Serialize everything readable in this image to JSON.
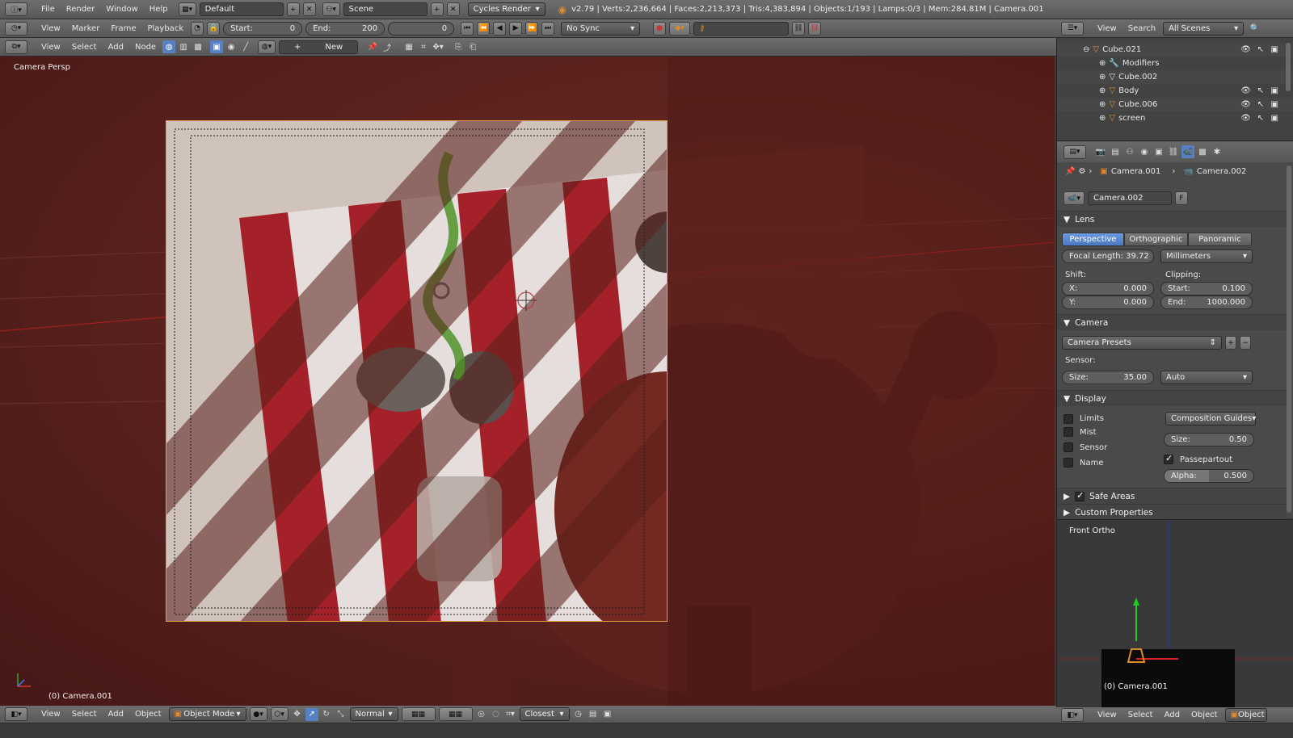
{
  "info_bar": {
    "menus": [
      "File",
      "Render",
      "Window",
      "Help"
    ],
    "layout": "Default",
    "scene": "Scene",
    "engine": "Cycles Render",
    "stats": "v2.79 | Verts:2,236,664 | Faces:2,213,373 | Tris:4,383,894 | Objects:1/193 | Lamps:0/3 | Mem:284.81M | Camera.001"
  },
  "timeline_bar": {
    "menus": [
      "View",
      "Marker",
      "Frame",
      "Playback"
    ],
    "start_label": "Start:",
    "start_value": "0",
    "end_label": "End:",
    "end_value": "200",
    "current_frame": "0",
    "sync": "No Sync"
  },
  "node_bar": {
    "menus": [
      "View",
      "Select",
      "Add",
      "Node"
    ],
    "new_label": "New"
  },
  "viewport": {
    "label": "Camera Persp",
    "footer": "(0) Camera.001"
  },
  "bottom_bar": {
    "menus": [
      "View",
      "Select",
      "Add",
      "Object"
    ],
    "mode": "Object Mode",
    "pivot": "Normal",
    "snap": "Closest"
  },
  "outliner": {
    "menus": [
      "View",
      "Search"
    ],
    "scenes": "All Scenes",
    "rows": [
      {
        "name": "Cube.021",
        "indent": 0
      },
      {
        "name": "Modifiers",
        "indent": 1
      },
      {
        "name": "Cube.002",
        "indent": 1
      },
      {
        "name": "Body",
        "indent": 1
      },
      {
        "name": "Cube.006",
        "indent": 1
      },
      {
        "name": "screen",
        "indent": 1
      }
    ]
  },
  "properties": {
    "breadcrumb": [
      "Camera.001",
      "Camera.002"
    ],
    "datablock": "Camera.002",
    "fake_user": "F",
    "lens": {
      "title": "Lens",
      "types": [
        "Perspective",
        "Orthographic",
        "Panoramic"
      ],
      "active_type": "Perspective",
      "focal_length": "Focal Length: 39.72",
      "units": "Millimeters",
      "shift_label": "Shift:",
      "shift_x_label": "X:",
      "shift_x": "0.000",
      "shift_y_label": "Y:",
      "shift_y": "0.000",
      "clipping_label": "Clipping:",
      "clip_start_label": "Start:",
      "clip_start": "0.100",
      "clip_end_label": "End:",
      "clip_end": "1000.000"
    },
    "camera": {
      "title": "Camera",
      "presets": "Camera Presets",
      "sensor_label": "Sensor:",
      "size_label": "Size:",
      "size_value": "35.00",
      "fit": "Auto"
    },
    "display": {
      "title": "Display",
      "checks": [
        {
          "label": "Limits",
          "checked": false
        },
        {
          "label": "Mist",
          "checked": false
        },
        {
          "label": "Sensor",
          "checked": false
        },
        {
          "label": "Name",
          "checked": false
        }
      ],
      "guides": "Composition Guides",
      "size_label": "Size:",
      "size_value": "0.50",
      "passepartout_label": "Passepartout",
      "passepartout_checked": true,
      "alpha_label": "Alpha:",
      "alpha_value": "0.500"
    },
    "safe_areas": {
      "title": "Safe Areas",
      "checked": true
    },
    "custom_properties": {
      "title": "Custom Properties"
    }
  },
  "front_view": {
    "label": "Front Ortho",
    "footer": "(0) Camera.001"
  }
}
